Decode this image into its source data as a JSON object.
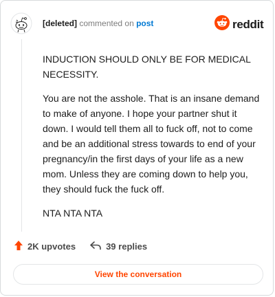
{
  "header": {
    "username": "[deleted]",
    "action_text": "commented on",
    "target_text": "post",
    "logo_text": "reddit"
  },
  "comment": {
    "paragraphs": [
      "INDUCTION SHOULD ONLY BE FOR MEDICAL NECESSITY.",
      "You are not the asshole. That is an insane demand to make of anyone. I hope your partner shut it down. I would tell them all to fuck off, not to come and be an additional stress towards to end of your pregnancy/in the first days of your life as a new mom. Unless they are coming down to help you, they should fuck the fuck off.",
      "NTA NTA NTA"
    ]
  },
  "stats": {
    "upvotes": "2K upvotes",
    "replies": "39 replies"
  },
  "footer": {
    "view_label": "View the conversation"
  },
  "colors": {
    "brand": "#ff4500",
    "link": "#0079d3",
    "text": "#1c1c1c"
  }
}
